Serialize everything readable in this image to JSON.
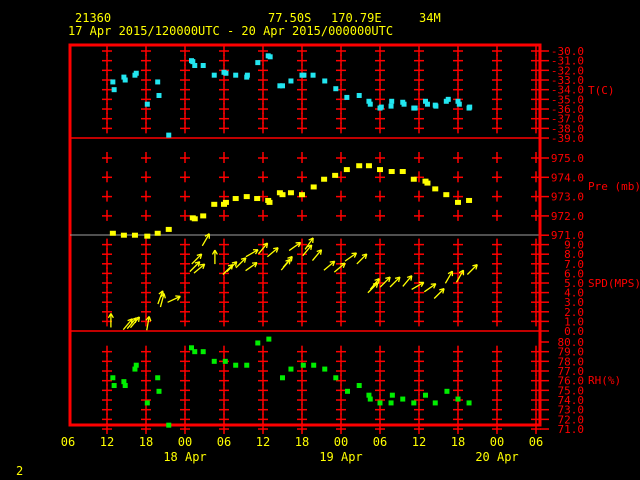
{
  "header": {
    "station": "21360",
    "latitude": "77.50S",
    "longitude": "170.79E",
    "elevation": "34M",
    "period": "17 Apr 2015/120000UTC - 20 Apr 2015/000000UTC"
  },
  "page_number": "2",
  "colors": {
    "frame": "#ff0000",
    "text": "#ffff00",
    "temperature": "#22e6f0",
    "pressure": "#ffff00",
    "wind": "#ffff00",
    "humidity": "#00ee00"
  },
  "chart_data": {
    "type": "scatter",
    "title": "21360 77.50S 170.79E 34M",
    "subtitle": "17 Apr 2015/120000UTC - 20 Apr 2015/000000UTC",
    "x_units": "hours since 17 Apr 2015 12UTC",
    "xlim": [
      -6,
      66
    ],
    "x_tick_labels": [
      "06",
      "12",
      "18",
      "00",
      "06",
      "12",
      "18",
      "00",
      "06",
      "12",
      "18",
      "00",
      "06"
    ],
    "x_date_labels": [
      {
        "label": "18 Apr",
        "at": 12
      },
      {
        "label": "19 Apr",
        "at": 36
      },
      {
        "label": "20 Apr",
        "at": 60
      }
    ],
    "panels": [
      {
        "name": "temperature",
        "ylabel": "T(C)",
        "ylim": [
          -39,
          -30
        ],
        "tick_labels": [
          "-30.0",
          "-31.0",
          "-32.0",
          "-33.0",
          "-34.0",
          "-35.0",
          "-36.0",
          "-37.0",
          "-38.0",
          "-39.0"
        ],
        "points": [
          [
            0.9,
            -33.2
          ],
          [
            1.1,
            -34.0
          ],
          [
            2.6,
            -32.7
          ],
          [
            2.8,
            -33.0
          ],
          [
            4.3,
            -32.5
          ],
          [
            4.5,
            -32.3
          ],
          [
            6.2,
            -35.5
          ],
          [
            7.8,
            -33.2
          ],
          [
            8.0,
            -34.6
          ],
          [
            9.5,
            -38.7
          ],
          [
            13.0,
            -31.0
          ],
          [
            13.2,
            -31.1
          ],
          [
            13.5,
            -31.5
          ],
          [
            14.8,
            -31.5
          ],
          [
            16.5,
            -32.5
          ],
          [
            18.0,
            -32.2
          ],
          [
            18.3,
            -32.3
          ],
          [
            19.8,
            -32.5
          ],
          [
            21.5,
            -32.7
          ],
          [
            21.6,
            -32.5
          ],
          [
            23.2,
            -31.2
          ],
          [
            24.8,
            -30.5
          ],
          [
            25.1,
            -30.6
          ],
          [
            26.6,
            -33.6
          ],
          [
            27.0,
            -33.6
          ],
          [
            28.3,
            -33.1
          ],
          [
            30.0,
            -32.5
          ],
          [
            30.3,
            -32.5
          ],
          [
            31.7,
            -32.5
          ],
          [
            33.5,
            -33.1
          ],
          [
            35.2,
            -33.9
          ],
          [
            36.9,
            -34.8
          ],
          [
            38.8,
            -34.6
          ],
          [
            40.3,
            -35.2
          ],
          [
            40.5,
            -35.5
          ],
          [
            42.0,
            -35.9
          ],
          [
            42.2,
            -35.8
          ],
          [
            43.7,
            -35.7
          ],
          [
            43.8,
            -35.2
          ],
          [
            45.5,
            -35.3
          ],
          [
            45.7,
            -35.5
          ],
          [
            47.2,
            -35.9
          ],
          [
            47.4,
            -35.9
          ],
          [
            49.0,
            -35.2
          ],
          [
            49.3,
            -35.5
          ],
          [
            50.5,
            -35.6
          ],
          [
            50.6,
            -35.7
          ],
          [
            52.2,
            -35.2
          ],
          [
            52.5,
            -35.0
          ],
          [
            54.0,
            -35.2
          ],
          [
            54.2,
            -35.5
          ],
          [
            55.7,
            -35.9
          ],
          [
            55.8,
            -35.8
          ]
        ]
      },
      {
        "name": "pressure",
        "ylabel": "Pre (mb)",
        "ylim": [
          971,
          975
        ],
        "tick_labels": [
          "975.0",
          "974.0",
          "973.0",
          "972.0",
          "971.0"
        ],
        "points": [
          [
            0.9,
            971.1
          ],
          [
            2.6,
            971.0
          ],
          [
            4.3,
            971.0
          ],
          [
            6.2,
            970.95
          ],
          [
            7.8,
            971.1
          ],
          [
            9.5,
            971.3
          ],
          [
            13.2,
            971.9
          ],
          [
            13.5,
            971.85
          ],
          [
            14.8,
            972.0
          ],
          [
            16.5,
            972.6
          ],
          [
            18.0,
            972.6
          ],
          [
            18.3,
            972.7
          ],
          [
            19.8,
            972.9
          ],
          [
            21.5,
            973.0
          ],
          [
            23.1,
            972.9
          ],
          [
            24.8,
            972.8
          ],
          [
            25.0,
            972.7
          ],
          [
            26.6,
            973.2
          ],
          [
            27.0,
            973.1
          ],
          [
            28.3,
            973.2
          ],
          [
            30.0,
            973.1
          ],
          [
            31.8,
            973.5
          ],
          [
            33.4,
            973.9
          ],
          [
            35.1,
            974.1
          ],
          [
            36.9,
            974.4
          ],
          [
            38.8,
            974.6
          ],
          [
            40.3,
            974.6
          ],
          [
            42.0,
            974.4
          ],
          [
            43.8,
            974.3
          ],
          [
            45.5,
            974.3
          ],
          [
            47.2,
            973.9
          ],
          [
            49.0,
            973.8
          ],
          [
            49.3,
            973.7
          ],
          [
            50.5,
            973.4
          ],
          [
            52.2,
            973.1
          ],
          [
            54.0,
            972.7
          ],
          [
            55.7,
            972.8
          ]
        ]
      },
      {
        "name": "wind",
        "ylabel": "SPD(MPS)",
        "ylim": [
          0,
          10
        ],
        "tick_labels": [
          "9.0",
          "8.0",
          "7.0",
          "6.0",
          "5.0",
          "4.0",
          "3.0",
          "2.0",
          "1.0",
          "0.0"
        ],
        "points_note": "[hour, speed, arrow direction degrees clockwise from up]",
        "points": [
          [
            0.6,
            1.1,
            0
          ],
          [
            3.2,
            0.7,
            40
          ],
          [
            3.8,
            0.8,
            40
          ],
          [
            4.3,
            0.9,
            40
          ],
          [
            6.3,
            0.8,
            10
          ],
          [
            8.2,
            3.5,
            20
          ],
          [
            8.5,
            3.2,
            15
          ],
          [
            10.3,
            3.3,
            65
          ],
          [
            15.2,
            9.5,
            30
          ],
          [
            13.8,
            7.5,
            45
          ],
          [
            13.5,
            6.7,
            45
          ],
          [
            14.2,
            6.5,
            50
          ],
          [
            16.6,
            7.7,
            0
          ],
          [
            18.6,
            6.4,
            45
          ],
          [
            19.2,
            6.7,
            45
          ],
          [
            20.6,
            7.1,
            45
          ],
          [
            22.2,
            6.7,
            55
          ],
          [
            22.3,
            8.1,
            60
          ],
          [
            24.0,
            8.6,
            40
          ],
          [
            25.5,
            8.2,
            50
          ],
          [
            27.5,
            6.9,
            40
          ],
          [
            27.8,
            7.2,
            40
          ],
          [
            28.9,
            8.8,
            55
          ],
          [
            30.8,
            8.4,
            40
          ],
          [
            31.1,
            9.1,
            35
          ],
          [
            32.3,
            7.9,
            40
          ],
          [
            34.2,
            6.8,
            50
          ],
          [
            35.8,
            6.6,
            50
          ],
          [
            37.5,
            7.7,
            55
          ],
          [
            39.2,
            7.5,
            45
          ],
          [
            40.9,
            4.5,
            45
          ],
          [
            41.2,
            4.9,
            40
          ],
          [
            42.8,
            5.1,
            45
          ],
          [
            44.3,
            5.1,
            45
          ],
          [
            46.2,
            5.2,
            40
          ],
          [
            47.8,
            4.7,
            60
          ],
          [
            49.7,
            4.5,
            55
          ],
          [
            51.1,
            3.9,
            45
          ],
          [
            52.6,
            5.6,
            30
          ],
          [
            54.3,
            5.7,
            30
          ],
          [
            56.2,
            6.4,
            45
          ]
        ]
      },
      {
        "name": "humidity",
        "ylabel": "RH(%)",
        "ylim": [
          71,
          80
        ],
        "tick_labels": [
          "80.0",
          "79.0",
          "78.0",
          "77.0",
          "76.0",
          "75.0",
          "74.0",
          "73.0",
          "72.0",
          "71.0"
        ],
        "points": [
          [
            0.9,
            76.3
          ],
          [
            1.1,
            75.5
          ],
          [
            2.6,
            75.9
          ],
          [
            2.8,
            75.5
          ],
          [
            4.3,
            77.2
          ],
          [
            4.5,
            77.6
          ],
          [
            6.2,
            73.7
          ],
          [
            7.8,
            76.3
          ],
          [
            8.0,
            74.9
          ],
          [
            9.5,
            71.4
          ],
          [
            13.0,
            79.4
          ],
          [
            13.5,
            79.0
          ],
          [
            14.8,
            79.0
          ],
          [
            16.5,
            78.0
          ],
          [
            18.2,
            78.0
          ],
          [
            19.8,
            77.6
          ],
          [
            21.5,
            77.6
          ],
          [
            23.2,
            79.9
          ],
          [
            24.9,
            80.3
          ],
          [
            27.0,
            76.3
          ],
          [
            28.3,
            77.2
          ],
          [
            30.2,
            77.6
          ],
          [
            31.8,
            77.6
          ],
          [
            33.5,
            77.2
          ],
          [
            35.2,
            76.3
          ],
          [
            37.0,
            74.9
          ],
          [
            38.8,
            75.5
          ],
          [
            40.3,
            74.5
          ],
          [
            40.5,
            74.1
          ],
          [
            42.0,
            73.7
          ],
          [
            43.7,
            73.7
          ],
          [
            43.9,
            74.5
          ],
          [
            45.5,
            74.1
          ],
          [
            47.2,
            73.7
          ],
          [
            49.0,
            74.5
          ],
          [
            50.5,
            73.7
          ],
          [
            52.3,
            74.9
          ],
          [
            54.0,
            74.1
          ],
          [
            55.7,
            73.7
          ]
        ]
      }
    ]
  }
}
